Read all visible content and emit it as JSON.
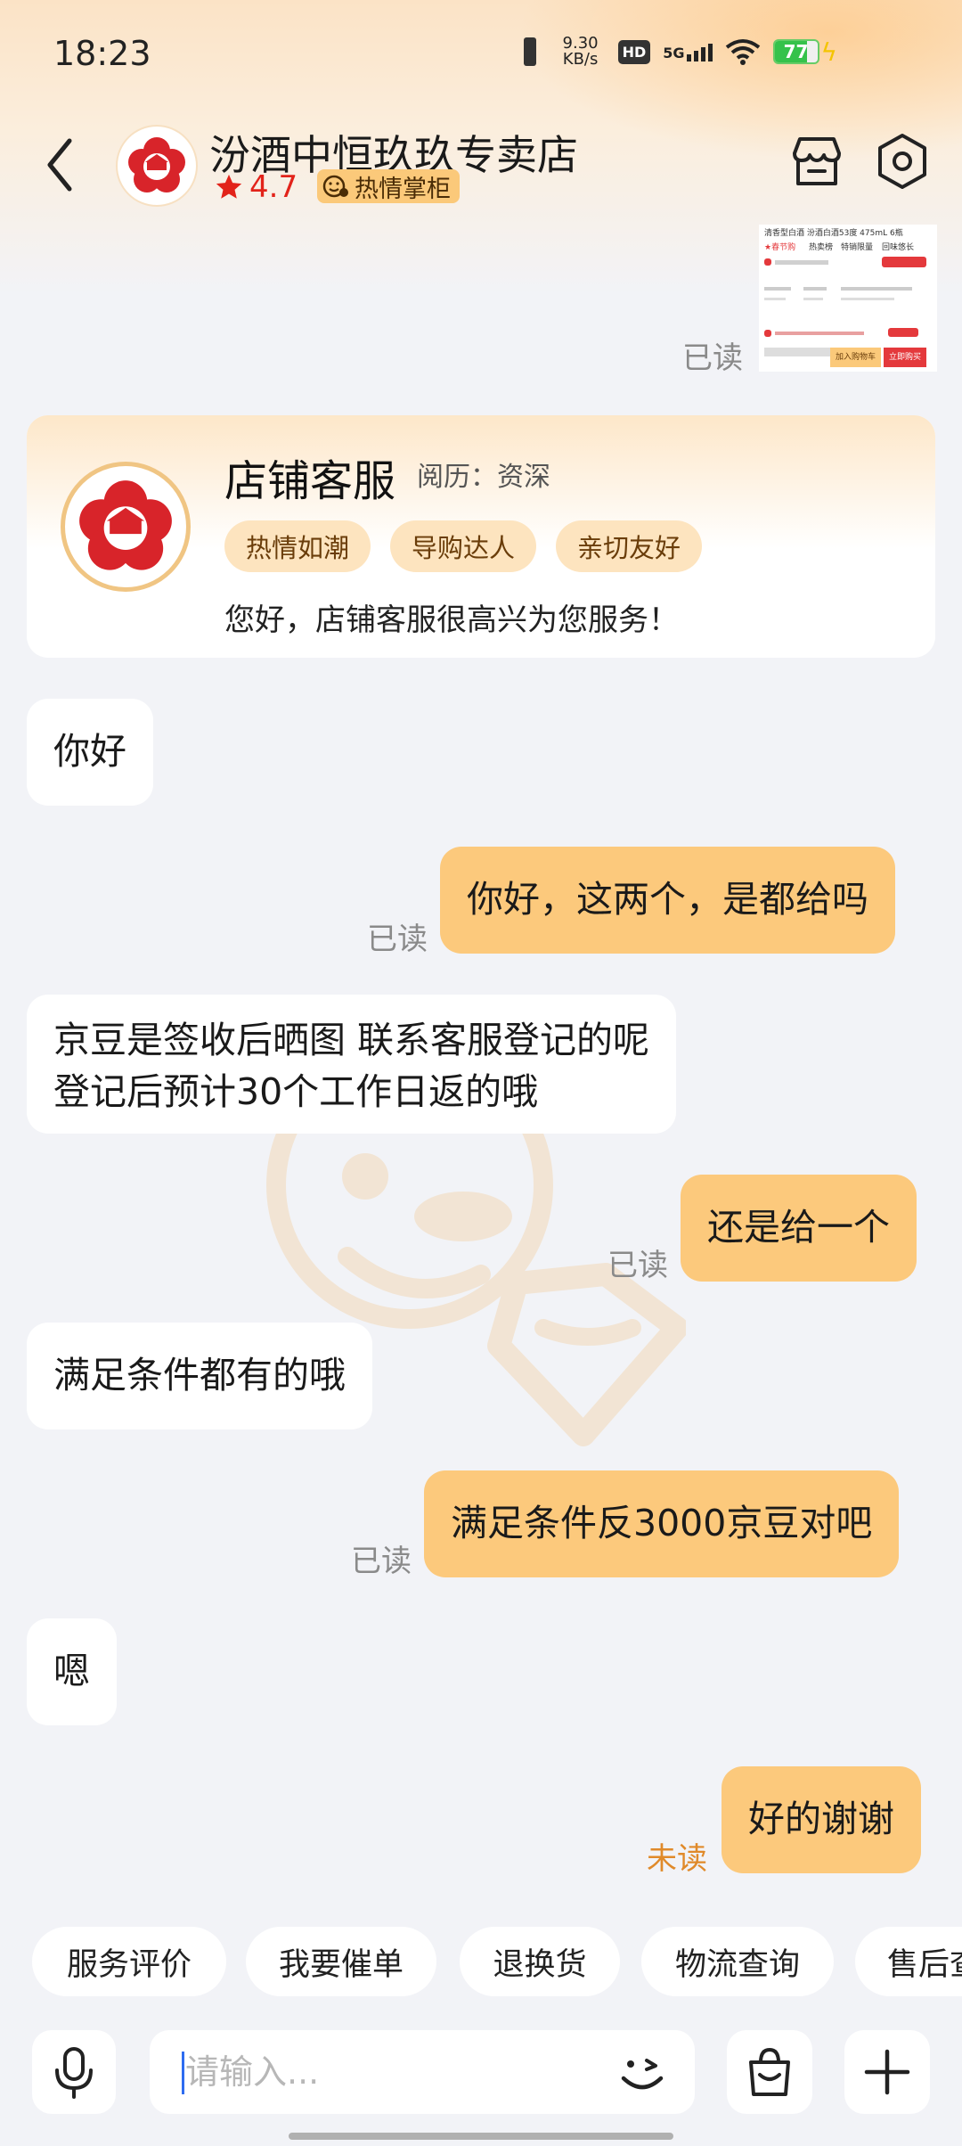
{
  "status_bar": {
    "time": "18:23",
    "net_speed_value": "9.30",
    "net_speed_unit": "KB/s",
    "hd": "HD",
    "network": "5G",
    "battery": "77",
    "icons": [
      "vibrate-icon",
      "hd-icon",
      "signal-icon",
      "wifi-icon",
      "battery-icon",
      "charging-icon"
    ]
  },
  "header": {
    "shop_name": "汾酒中恒玖玖专卖店",
    "rating": "4.7",
    "badge": "热情掌柜",
    "icons": [
      "back-icon",
      "store-icon",
      "settings-icon"
    ]
  },
  "product_thumb": {
    "title": "清香型白酒 汾酒白酒53度 475mL 6瓶",
    "tags": [
      "★春节购",
      "热卖榜",
      "特销限量",
      "回味悠长"
    ],
    "cart_btn": "加入购物车",
    "buy_btn": "立即购买"
  },
  "read_label": "已读",
  "unread_label": "未读",
  "agent_card": {
    "title": "店铺客服",
    "experience": "阅历：资深",
    "tags": [
      "热情如潮",
      "导购达人",
      "亲切友好"
    ],
    "greeting": "您好，店铺客服很高兴为您服务！"
  },
  "messages": [
    {
      "side": "in",
      "text": "你好"
    },
    {
      "side": "out",
      "text": "你好，这两个，是都给吗",
      "status": "已读"
    },
    {
      "side": "in",
      "line1": "京豆是签收后晒图 联系客服登记的呢",
      "line2": "登记后预计30个工作日返的哦"
    },
    {
      "side": "out",
      "text": "还是给一个",
      "status": "已读"
    },
    {
      "side": "in",
      "text": "满足条件都有的哦"
    },
    {
      "side": "out",
      "text": "满足条件反3000京豆对吧",
      "status": "已读"
    },
    {
      "side": "in",
      "text": "嗯"
    },
    {
      "side": "out",
      "text": "好的谢谢",
      "status": "未读"
    }
  ],
  "quick_replies": [
    "服务评价",
    "我要催单",
    "退换货",
    "物流查询",
    "售后查"
  ],
  "input": {
    "placeholder": "请输入..."
  },
  "colors": {
    "outgoing_bubble": "#fcc97c",
    "incoming_bubble": "#ffffff",
    "background": "#f2f3f7",
    "rating_red": "#e2231a",
    "unread_orange": "#e08a2a"
  }
}
